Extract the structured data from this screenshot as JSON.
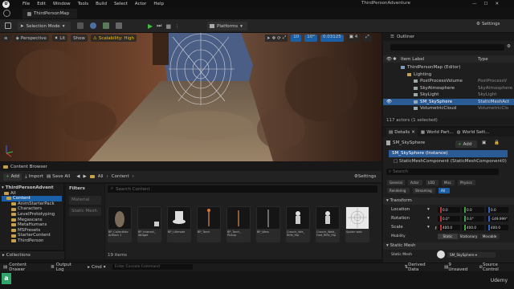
{
  "menu": {
    "items": [
      "File",
      "Edit",
      "Window",
      "Tools",
      "Build",
      "Select",
      "Actor",
      "Help"
    ]
  },
  "window": {
    "project_name": "ThirdPersonAdventure",
    "map_tab": "ThirdPersonMap",
    "min": "—",
    "max": "☐",
    "close": "✕"
  },
  "toolbar": {
    "selection_mode": "Selection Mode",
    "platforms": "Platforms",
    "settings": "Settings"
  },
  "viewport": {
    "perspective": "Perspective",
    "lit": "Lit",
    "show": "Show",
    "scalability": "Scalability: High",
    "snap": "10",
    "angle": "10°",
    "scale_snap": "0.03125",
    "cam_speed": "4"
  },
  "content_browser": {
    "tabs": {
      "content_browser": "Content Browser"
    },
    "add": "Add",
    "import": "Import",
    "save_all": "Save All",
    "breadcrumb": [
      "All",
      "Content"
    ],
    "settings": "Settings",
    "project_root": "ThirdPersonAdvent",
    "tree": [
      "All",
      "Content",
      "AnimStarterPack",
      "Characters",
      "LevelPrototyping",
      "Megascans",
      "MetaHumans",
      "MSPresets",
      "StarterContent",
      "ThirdPerson"
    ],
    "collections": "Collections",
    "filters_title": "Filters",
    "filters": [
      "Material",
      "Static Mesh"
    ],
    "search_placeholder": "Search Content",
    "items_count": "19 items",
    "assets": [
      {
        "label": "BP_Collectible Artifact 1"
      },
      {
        "label": "BP_Interact_ Widget"
      },
      {
        "label": "BP_Ultimate"
      },
      {
        "label": "BP_Torch"
      },
      {
        "label": "BP_Torch_ Pickup"
      },
      {
        "label": "BP_Wars"
      },
      {
        "label": "Crouch_Idle_ Rifle_Hip"
      },
      {
        "label": "Crouch_Walk_ Fwd_Rifle_Hip"
      },
      {
        "label": "Spider web"
      }
    ]
  },
  "bottom_bar": {
    "content_drawer": "Content Drawer",
    "output_log": "Output Log",
    "cmd": "Cmd",
    "console_placeholder": "Enter Console Command",
    "derived_data": "Derived Data",
    "unsaved": "9 Unsaved",
    "source_control": "Source Control"
  },
  "outliner": {
    "title": "Outliner",
    "col_label": "Item Label",
    "col_type": "Type",
    "rows": [
      {
        "name": "ThirdPersonMap (Editor)",
        "type": "",
        "indent": 1,
        "kind": "map"
      },
      {
        "name": "Lighting",
        "type": "",
        "indent": 2,
        "kind": "folder"
      },
      {
        "name": "PostProcessVolume",
        "type": "PostProcessV",
        "indent": 3,
        "kind": "actor"
      },
      {
        "name": "SkyAtmosphere",
        "type": "SkyAtmosphere",
        "indent": 3,
        "kind": "actor"
      },
      {
        "name": "SkyLight",
        "type": "SkyLight",
        "indent": 3,
        "kind": "actor"
      },
      {
        "name": "SM_SkySphere",
        "type": "StaticMeshAct",
        "indent": 3,
        "kind": "actor",
        "selected": true
      },
      {
        "name": "VolumetricCloud",
        "type": "VolumetricClo",
        "indent": 3,
        "kind": "actor"
      }
    ],
    "footer": "117 actors (1 selected)"
  },
  "details": {
    "tabs": [
      "Details",
      "World Part...",
      "World Sett..."
    ],
    "actor_name": "SM_SkySphere",
    "add": "Add",
    "instance": "SM_SkySphere (Instance)",
    "component": "StaticMeshComponent (StaticMeshComponent0)",
    "search_placeholder": "Search",
    "filters_row1": [
      "General",
      "Actor",
      "LOD",
      "Misc",
      "Physics"
    ],
    "filters_row2": [
      "Rendering",
      "Streaming",
      "All"
    ],
    "transform_header": "Transform",
    "location": {
      "label": "Location",
      "x": "0.0",
      "y": "0.0",
      "z": "0.0"
    },
    "rotation": {
      "label": "Rotation",
      "x": "0.0°",
      "y": "0.0°",
      "z": "-149.999°"
    },
    "scale": {
      "label": "Scale",
      "x": "400.0",
      "y": "400.0",
      "z": "400.0"
    },
    "mobility": {
      "label": "Mobility",
      "options": [
        "Static",
        "Stationary",
        "Movable"
      ]
    },
    "static_mesh_header": "Static Mesh",
    "static_mesh_label": "Static Mesh",
    "static_mesh_value": "SM_SkySphere"
  },
  "watermark": {
    "brand": "Udemy"
  },
  "colors": {
    "accent_blue": "#1b5fa6",
    "selection": "#2a5b94",
    "play_green": "#3fbf3f",
    "scalability": "#f0c000",
    "folder": "#c9a04a"
  }
}
